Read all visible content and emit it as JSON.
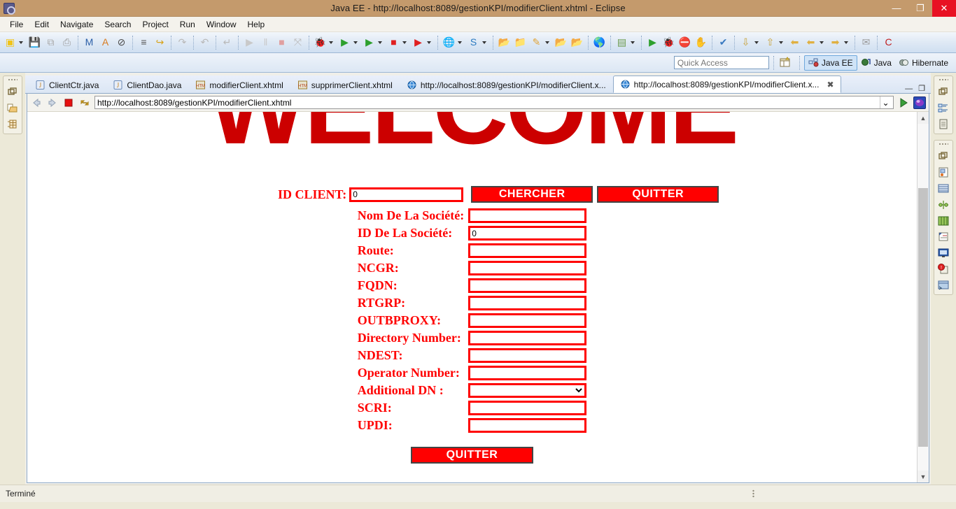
{
  "window": {
    "title": "Java EE - http://localhost:8089/gestionKPI/modifierClient.xhtml - Eclipse",
    "minimize": "—",
    "maximize": "❐",
    "close": "✕"
  },
  "menubar": {
    "items": [
      "File",
      "Edit",
      "Navigate",
      "Search",
      "Project",
      "Run",
      "Window",
      "Help"
    ]
  },
  "toolbar": {
    "groups": [
      {
        "items": [
          {
            "name": "new-wizard-icon",
            "glyph": "▣",
            "color": "#f0c419",
            "dropdown": true
          },
          {
            "name": "save-icon",
            "glyph": "💾",
            "color": "#a8a8a8",
            "dropdown": false
          },
          {
            "name": "save-all-icon",
            "glyph": "⧉",
            "color": "#a8a8a8",
            "dropdown": false
          },
          {
            "name": "print-icon",
            "glyph": "⎙",
            "color": "#9a9a9a",
            "dropdown": false
          }
        ]
      },
      {
        "items": [
          {
            "name": "maven-build-icon",
            "glyph": "M",
            "color": "#2b5fa8",
            "dropdown": false
          },
          {
            "name": "new-java-annotation-icon",
            "glyph": "A",
            "color": "#d87b20",
            "dropdown": false
          },
          {
            "name": "toggle-breakpoint-icon",
            "glyph": "⊘",
            "color": "#4a4a4a",
            "dropdown": false
          }
        ]
      },
      {
        "items": [
          {
            "name": "open-task-icon",
            "glyph": "≡",
            "color": "#555",
            "dropdown": false
          },
          {
            "name": "link-task-icon",
            "glyph": "↪",
            "color": "#d8a31a",
            "dropdown": false
          }
        ]
      },
      {
        "items": [
          {
            "name": "redo-icon",
            "glyph": "↷",
            "color": "#b9b9b9",
            "dropdown": false
          }
        ]
      },
      {
        "items": [
          {
            "name": "undo-icon",
            "glyph": "↶",
            "color": "#b9b9b9",
            "dropdown": false
          }
        ]
      },
      {
        "items": [
          {
            "name": "step-return-icon",
            "glyph": "↵",
            "color": "#b9b9b9",
            "dropdown": false
          }
        ]
      },
      {
        "items": [
          {
            "name": "resume-icon",
            "glyph": "▶",
            "color": "#c9c9c9",
            "dropdown": false
          },
          {
            "name": "suspend-icon",
            "glyph": "‖",
            "color": "#c9c9c9",
            "dropdown": false
          },
          {
            "name": "terminate-icon",
            "glyph": "■",
            "color": "#e0a0a0",
            "dropdown": false
          },
          {
            "name": "disconnect-icon",
            "glyph": "⤧",
            "color": "#b9b9b9",
            "dropdown": false
          }
        ]
      },
      {
        "items": [
          {
            "name": "debug-icon",
            "glyph": "🐞",
            "color": "#5a8f3a",
            "dropdown": true
          },
          {
            "name": "run-icon",
            "glyph": "▶",
            "color": "#2ea02e",
            "dropdown": true
          },
          {
            "name": "run-server-icon",
            "glyph": "▶",
            "color": "#2ea02e",
            "dropdown": true
          },
          {
            "name": "stop-icon",
            "glyph": "■",
            "color": "#e02020",
            "dropdown": true
          },
          {
            "name": "run-last-tool-icon",
            "glyph": "▶",
            "color": "#e02020",
            "dropdown": true
          }
        ]
      },
      {
        "items": [
          {
            "name": "new-server-icon",
            "glyph": "🌐",
            "color": "#3a6ea5",
            "dropdown": true
          },
          {
            "name": "new-session-icon",
            "glyph": "S",
            "color": "#2a7ac0",
            "dropdown": true
          }
        ]
      },
      {
        "items": [
          {
            "name": "open-type-icon",
            "glyph": "📂",
            "color": "#e0a53a",
            "dropdown": false
          },
          {
            "name": "open-resource-icon",
            "glyph": "📁",
            "color": "#e0a53a",
            "dropdown": false
          },
          {
            "name": "edit-icon",
            "glyph": "✎",
            "color": "#e0a53a",
            "dropdown": true
          },
          {
            "name": "search-folder-icon",
            "glyph": "📂",
            "color": "#c9a05a",
            "dropdown": false
          },
          {
            "name": "open-folder-icon",
            "glyph": "📂",
            "color": "#e0a53a",
            "dropdown": false
          }
        ]
      },
      {
        "items": [
          {
            "name": "web-browser-icon",
            "glyph": "🌎",
            "color": "#2a7ac0",
            "dropdown": false
          }
        ]
      },
      {
        "items": [
          {
            "name": "server-view-icon",
            "glyph": "▤",
            "color": "#6a9a4a",
            "dropdown": true
          }
        ]
      },
      {
        "items": [
          {
            "name": "run-as-icon",
            "glyph": "▶",
            "color": "#2ea02e",
            "dropdown": false
          },
          {
            "name": "debug-as-icon",
            "glyph": "🐞",
            "color": "#5a8f3a",
            "dropdown": false
          },
          {
            "name": "terminate-server-icon",
            "glyph": "⛔",
            "color": "#d02020",
            "dropdown": false
          },
          {
            "name": "profile-icon",
            "glyph": "✋",
            "color": "#888",
            "dropdown": false
          }
        ]
      },
      {
        "items": [
          {
            "name": "validate-icon",
            "glyph": "✔",
            "color": "#3a7ac0",
            "dropdown": false
          }
        ]
      },
      {
        "items": [
          {
            "name": "next-annotation-icon",
            "glyph": "⇩",
            "color": "#c8a23a",
            "dropdown": true
          },
          {
            "name": "previous-annotation-icon",
            "glyph": "⇧",
            "color": "#c8a23a",
            "dropdown": true
          },
          {
            "name": "back-icon",
            "glyph": "⬅",
            "color": "#e0b040",
            "dropdown": false
          },
          {
            "name": "last-edit-icon",
            "glyph": "⬅",
            "color": "#e0b040",
            "dropdown": true
          },
          {
            "name": "forward-icon",
            "glyph": "➡",
            "color": "#e0b040",
            "dropdown": true
          }
        ]
      },
      {
        "items": [
          {
            "name": "new-email-icon",
            "glyph": "✉",
            "color": "#9a9a9a",
            "dropdown": false
          }
        ]
      },
      {
        "items": [
          {
            "name": "hibernate-icon",
            "glyph": "C",
            "color": "#c02020",
            "dropdown": false
          }
        ]
      }
    ]
  },
  "quick_access": {
    "placeholder": "Quick Access",
    "open_perspective_icon": "open-perspective-icon",
    "perspectives": [
      {
        "label": "Java EE",
        "icon": "java-ee-perspective-icon",
        "active": true
      },
      {
        "label": "Java",
        "icon": "java-perspective-icon",
        "active": false
      },
      {
        "label": "Hibernate",
        "icon": "hibernate-perspective-icon",
        "active": false
      }
    ]
  },
  "left_rail": {
    "groups": [
      {
        "icons": [
          "restore-view-icon",
          "project-explorer-icon",
          "servers-view-icon"
        ]
      }
    ]
  },
  "right_rail": {
    "groups": [
      {
        "icons": [
          "restore-view-icon",
          "outline-view-icon",
          "task-list-icon"
        ]
      },
      {
        "icons": [
          "restore-view-icon",
          "palette-view-icon",
          "properties-view-icon",
          "snippets-view-icon",
          "data-source-explorer-icon",
          "markers-view-icon",
          "console-view-icon",
          "error-log-icon",
          "hibernate-configurations-icon"
        ]
      }
    ]
  },
  "editor_tabs": [
    {
      "label": "ClientCtr.java",
      "icon": "java-file-icon",
      "active": false,
      "closable": false
    },
    {
      "label": "ClientDao.java",
      "icon": "java-file-icon",
      "active": false,
      "closable": false
    },
    {
      "label": "modifierClient.xhtml",
      "icon": "html-file-icon",
      "active": false,
      "closable": false
    },
    {
      "label": "supprimerClient.xhtml",
      "icon": "html-file-icon",
      "active": false,
      "closable": false
    },
    {
      "label": "http://localhost:8089/gestionKPI/modifierClient.x...",
      "icon": "web-browser-icon",
      "active": false,
      "closable": false
    },
    {
      "label": "http://localhost:8089/gestionKPI/modifierClient.x...",
      "icon": "web-browser-icon",
      "active": true,
      "closable": true,
      "close_glyph": "✖"
    }
  ],
  "editor_window_buttons": {
    "minimize": "—",
    "maximize": "❐"
  },
  "browser": {
    "back_icon": "back-arrow-icon",
    "forward_icon": "forward-arrow-icon",
    "stop_icon": "stop-icon",
    "refresh_icon": "refresh-icon",
    "url": "http://localhost:8089/gestionKPI/modifierClient.xhtml",
    "dropdown_glyph": "⌄",
    "go_icon": "go-arrow-icon",
    "open-external-icon": "open-external-browser-icon"
  },
  "page": {
    "banner_text": "WELCOME",
    "banner_color": "#cc0000",
    "id_client": {
      "label": "ID CLIENT:",
      "value": "0",
      "search_button": "CHERCHER",
      "quit_button": "QUITTER"
    },
    "fields": [
      {
        "label": "Nom De La Société:",
        "value": "",
        "type": "text",
        "name": "nom-de-la-societe-field"
      },
      {
        "label": "ID De La Société:",
        "value": "0",
        "type": "text",
        "name": "id-de-la-societe-field"
      },
      {
        "label": "Route:",
        "value": "",
        "type": "text",
        "name": "route-field"
      },
      {
        "label": "NCGR:",
        "value": "",
        "type": "text",
        "name": "ncgr-field"
      },
      {
        "label": "FQDN:",
        "value": "",
        "type": "text",
        "name": "fqdn-field"
      },
      {
        "label": "RTGRP:",
        "value": "",
        "type": "text",
        "name": "rtgrp-field"
      },
      {
        "label": "OUTBPROXY:",
        "value": "",
        "type": "text",
        "name": "outbproxy-field"
      },
      {
        "label": "Directory Number:",
        "value": "",
        "type": "text",
        "name": "directory-number-field"
      },
      {
        "label": "NDEST:",
        "value": "",
        "type": "text",
        "name": "ndest-field"
      },
      {
        "label": "Operator Number:",
        "value": "",
        "type": "text",
        "name": "operator-number-field"
      },
      {
        "label": "Additional DN :",
        "value": "",
        "type": "select",
        "name": "additional-dn-select",
        "options": [
          ""
        ]
      },
      {
        "label": "SCRI:",
        "value": "",
        "type": "text",
        "name": "scri-field"
      },
      {
        "label": "UPDI:",
        "value": "",
        "type": "text",
        "name": "updi-field"
      }
    ],
    "bottom_button": "QUITTER",
    "label_color": "#ff0000",
    "button_bg": "#ff0000"
  },
  "status": {
    "text": "Terminé"
  }
}
